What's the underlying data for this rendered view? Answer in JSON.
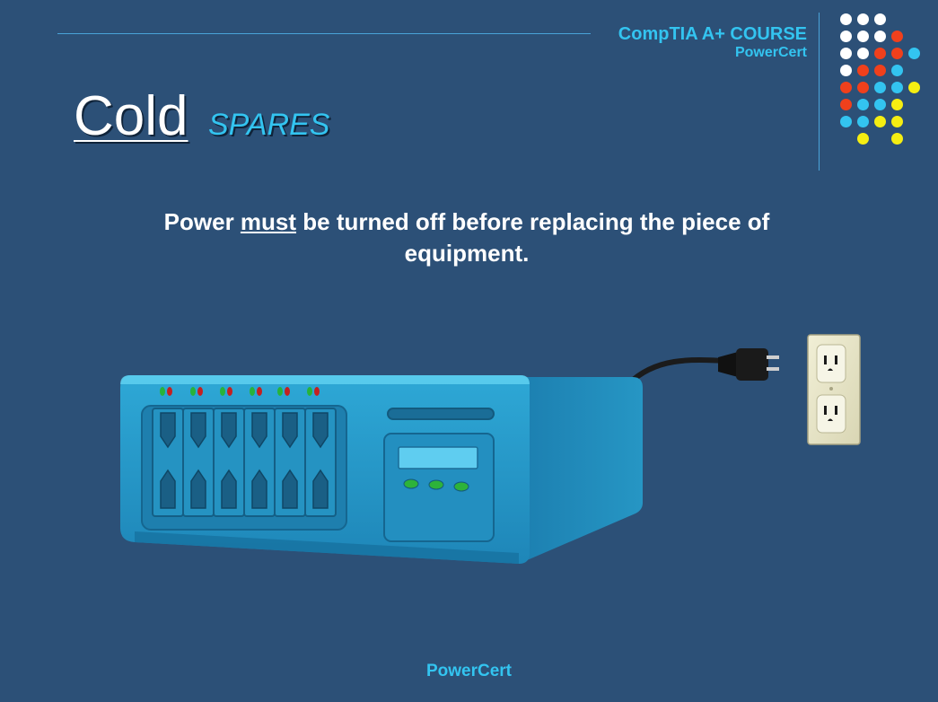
{
  "header": {
    "course_title": "CompTIA A+ COURSE",
    "brand": "PowerCert"
  },
  "slide": {
    "title_main": "Cold",
    "title_sub": "SPARES",
    "body_before": "Power ",
    "body_emphasis": "must",
    "body_after": " be turned off before replacing the piece of equipment."
  },
  "footer": {
    "brand": "PowerCert"
  },
  "colors": {
    "background": "#2c5077",
    "accent": "#33c4f0",
    "dot_white": "#ffffff",
    "dot_red": "#f0401c",
    "dot_blue": "#33c4f0",
    "dot_yellow": "#f5ee12"
  },
  "illustration": {
    "equipment": "server-icon",
    "outlet": "power-outlet-icon",
    "plug": "power-plug-icon"
  }
}
